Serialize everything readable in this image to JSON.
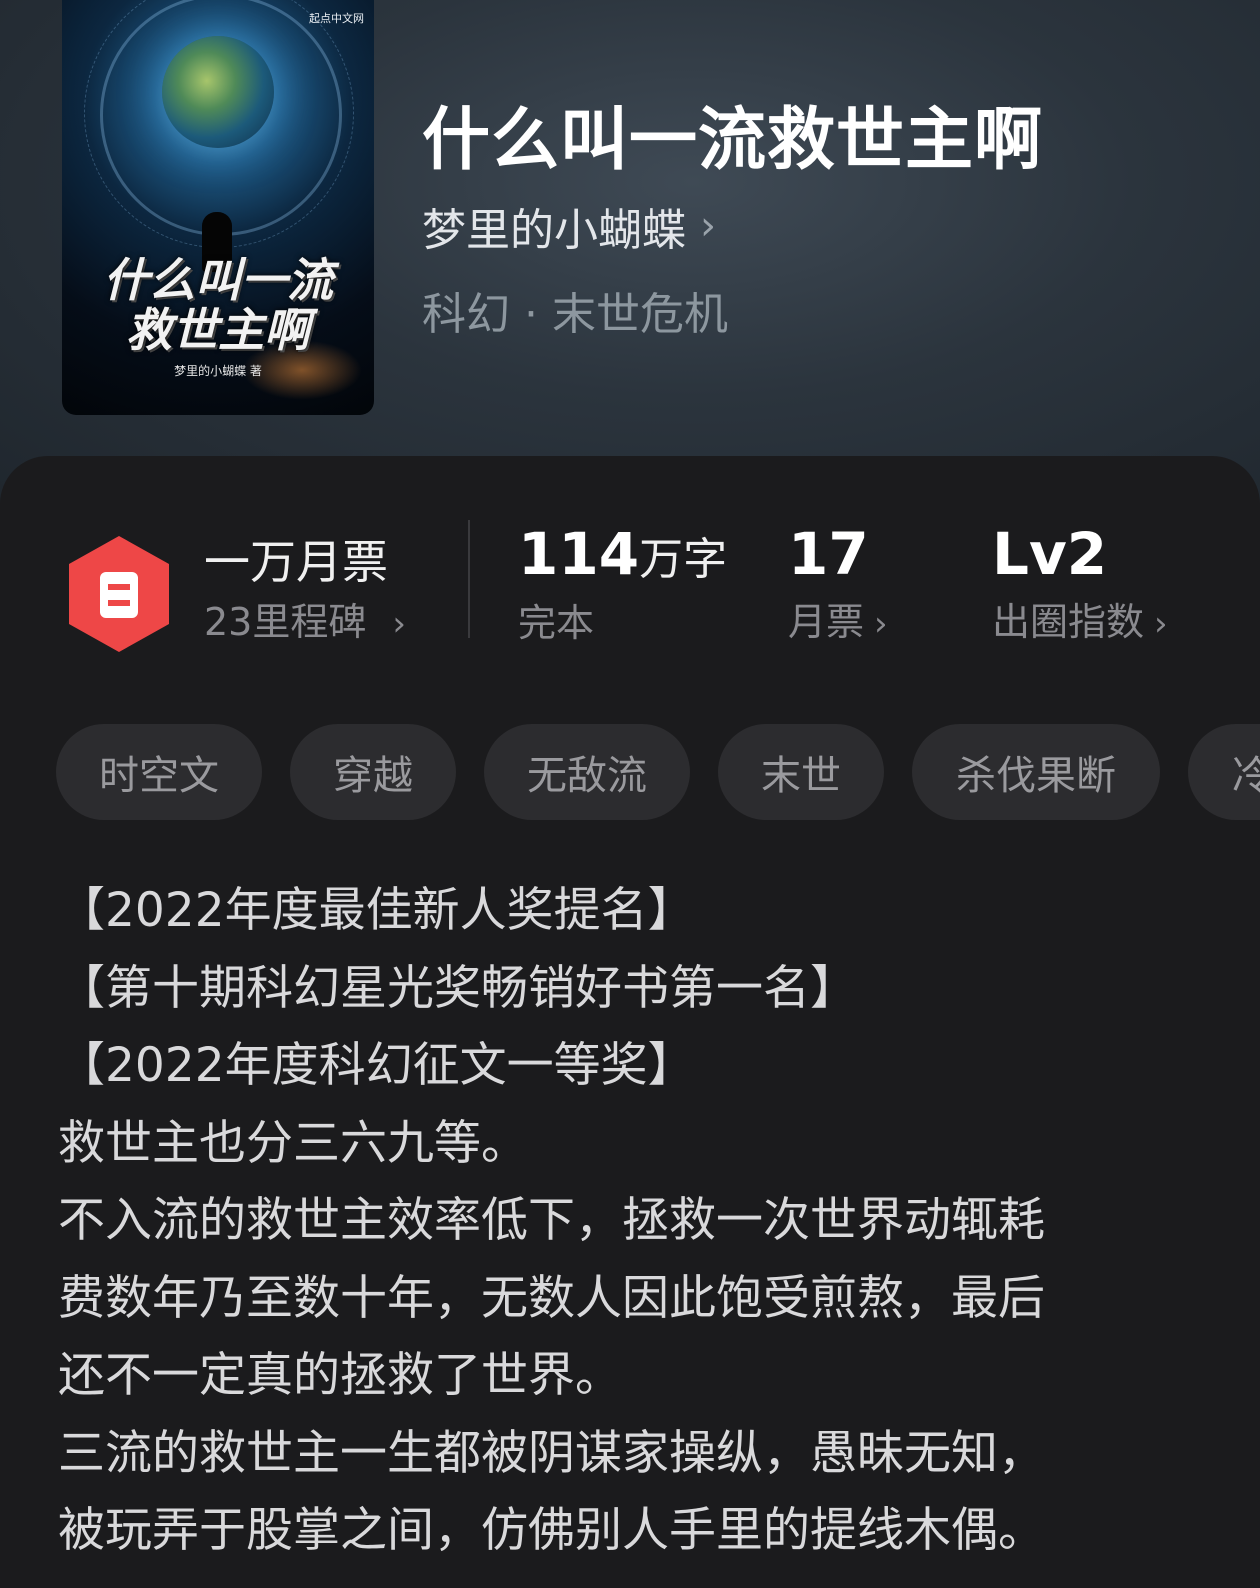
{
  "book": {
    "title": "什么叫一流救世主啊",
    "author": "梦里的小蝴蝶",
    "author_chevron": "›",
    "genre": "科幻 · 末世危机",
    "cover": {
      "title_line1": "什么叫一流",
      "title_line2": "救世主啊",
      "author": "梦里的小蝴蝶 著",
      "publisher_logo": "起点中文网"
    }
  },
  "stats": {
    "ticket": {
      "headline": "一万月票",
      "sub": "23里程碑",
      "icon": "ticket-icon",
      "color": "#f04a4a"
    },
    "words": {
      "value": "114",
      "unit": "万字",
      "sub": "完本"
    },
    "monthly": {
      "value": "17",
      "sub": "月票"
    },
    "influence": {
      "value": "Lv2",
      "sub": "出圈指数"
    }
  },
  "tags": [
    "时空文",
    "穿越",
    "无敌流",
    "末世",
    "杀伐果断",
    "冷"
  ],
  "description": {
    "awards": [
      "【2022年度最佳新人奖提名】",
      "【第十期科幻星光奖畅销好书第一名】",
      "【2022年度科幻征文一等奖】"
    ],
    "lines": [
      "救世主也分三六九等。",
      "不入流的救世主效率低下，拯救一次世界动辄耗",
      "费数年乃至数十年，无数人因此饱受煎熬，最后",
      "还不一定真的拯救了世界。",
      "三流的救世主一生都被阴谋家操纵，愚昧无知，",
      "被玩弄于股掌之间，仿佛别人手里的提线木偶。"
    ]
  }
}
